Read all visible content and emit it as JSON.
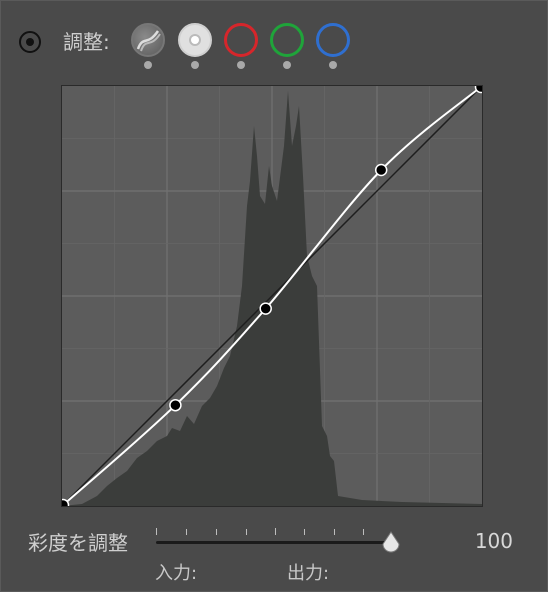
{
  "header": {
    "adjust_label": "調整:",
    "icons": {
      "target": "target-adjust-icon",
      "parametric": "parametric-curve-icon",
      "rgb": "rgb-channel",
      "red": "red-channel",
      "green": "green-channel",
      "blue": "blue-channel"
    },
    "channel_colors": {
      "red": "#d6262b",
      "green": "#1fa43a",
      "blue": "#2f6fd0",
      "rgb": "#e0e0e0"
    }
  },
  "curve": {
    "points": [
      [
        0,
        0
      ],
      [
        0.27,
        0.24
      ],
      [
        0.485,
        0.47
      ],
      [
        0.76,
        0.8
      ],
      [
        1,
        1
      ]
    ],
    "grid": true
  },
  "saturation": {
    "label": "彩度を調整",
    "value": "100",
    "fraction": 1.0
  },
  "io": {
    "input_label": "入力:",
    "output_label": "出力:"
  }
}
